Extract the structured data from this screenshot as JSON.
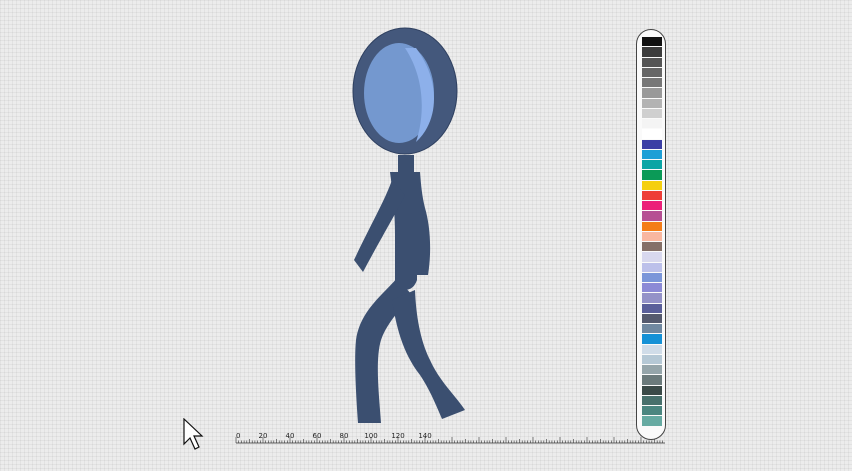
{
  "canvas": {
    "figure_color": "#3b4f70",
    "head_outline_color": "#44587c",
    "face_color": "#7498cf",
    "face_highlight_color": "#8db0ea"
  },
  "palette": {
    "swatches": [
      "#111111",
      "#3c3c3c",
      "#555555",
      "#666666",
      "#777777",
      "#999999",
      "#b3b3b3",
      "#cfcfcf",
      "#f4f4f4",
      "#ffffff",
      "#3b3ea5",
      "#1e9fd6",
      "#0ba5a5",
      "#0b9a57",
      "#f5cf0e",
      "#ee3d37",
      "#ec1f79",
      "#b64f93",
      "#f47d18",
      "#f9b7a0",
      "#857068",
      "#d8d8ee",
      "#bcc0ea",
      "#7b96d9",
      "#8c8ad6",
      "#9492c8",
      "#5a5f9a",
      "#555a6e",
      "#7088a0",
      "#1591d6",
      "#d0dce8",
      "#b5c8d5",
      "#95a5aa",
      "#6b7a7b",
      "#3b4a48",
      "#48706c",
      "#4b8680",
      "#66aaa2"
    ]
  },
  "ruler": {
    "labels": [
      "0",
      "20",
      "40",
      "60",
      "80",
      "100",
      "120",
      "140"
    ]
  }
}
